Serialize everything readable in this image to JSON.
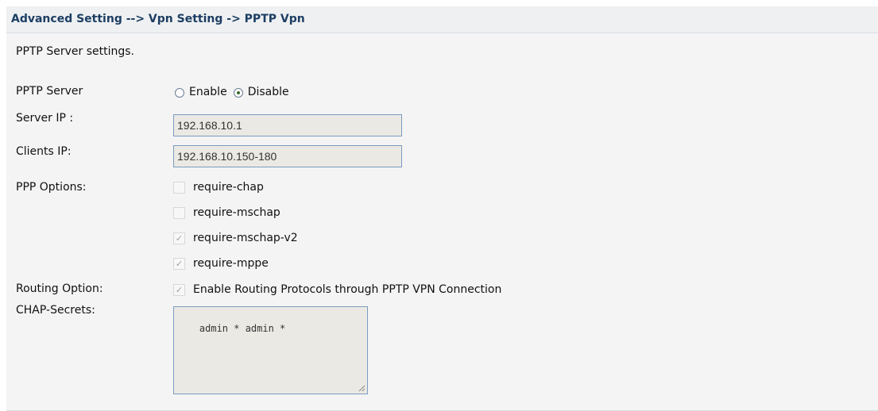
{
  "header": {
    "breadcrumb": "Advanced Setting --> Vpn Setting -> PPTP Vpn"
  },
  "section": {
    "title": "PPTP Server settings."
  },
  "pptp_server": {
    "label": "PPTP Server",
    "options": [
      {
        "label": "Enable",
        "selected": false
      },
      {
        "label": "Disable",
        "selected": true
      }
    ]
  },
  "server_ip": {
    "label": "Server IP :",
    "value": "192.168.10.1"
  },
  "clients_ip": {
    "label": "Clients IP:",
    "value": "192.168.10.150-180"
  },
  "ppp_options": {
    "label": "PPP Options:",
    "items": [
      {
        "label": "require-chap",
        "checked": false
      },
      {
        "label": "require-mschap",
        "checked": false
      },
      {
        "label": "require-mschap-v2",
        "checked": true
      },
      {
        "label": "require-mppe",
        "checked": true
      }
    ]
  },
  "routing_option": {
    "label": "Routing Option:",
    "item": {
      "label": "Enable Routing Protocols through PPTP VPN Connection",
      "checked": true
    }
  },
  "chap_secrets": {
    "label": "CHAP-Secrets:",
    "value": "admin * admin *"
  },
  "colors": {
    "header_text": "#1d3e63",
    "panel_bg": "#f4f4f4",
    "input_bg": "#ebe9e3",
    "input_border": "#7a9cc2"
  }
}
